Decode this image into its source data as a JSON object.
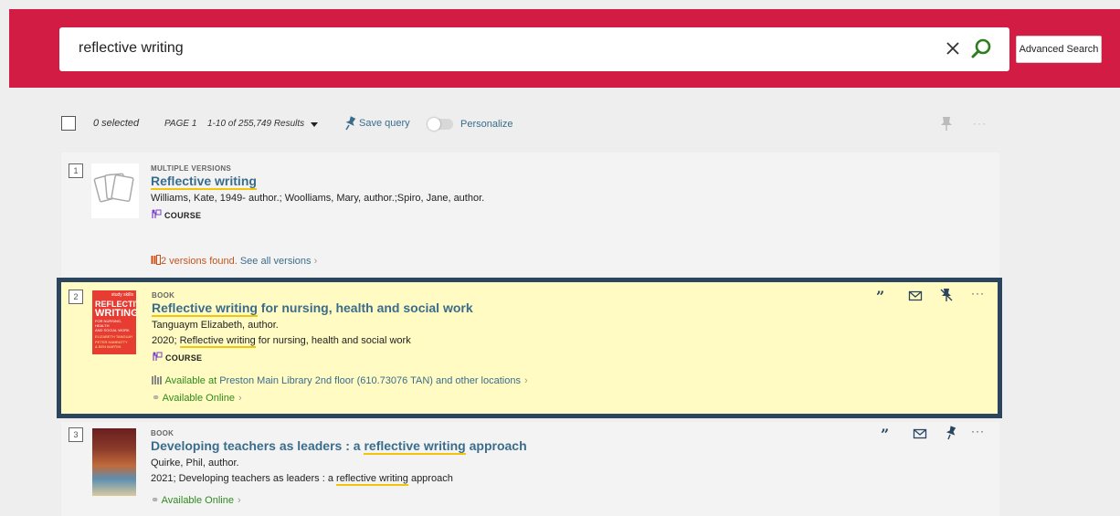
{
  "search": {
    "query": "reflective writing",
    "advanced_label": "Advanced Search"
  },
  "toolbar": {
    "selected": "0 selected",
    "page": "PAGE 1",
    "results": "1-10 of 255,749 Results",
    "save_query": "Save query",
    "personalize": "Personalize",
    "more": "···"
  },
  "results": [
    {
      "num": "1",
      "type": "MULTIPLE VERSIONS",
      "title_hl": "Reflective writing",
      "title_rest": "",
      "authors": "Williams, Kate, 1949- author.; Woolliams, Mary, author.;Spiro, Jane, author.",
      "course": "COURSE",
      "versions_found": "2 versions found.",
      "see_all": "See all versions"
    },
    {
      "num": "2",
      "type": "BOOK",
      "title_hl": "Reflective writing",
      "title_rest": " for nursing, health and social work",
      "authors": "Tanguaym Elizabeth, author.",
      "pub_prefix": "2020; ",
      "pub_hl": "Reflective writing",
      "pub_rest": " for nursing, health and social work",
      "course": "COURSE",
      "avail_at": "Available at",
      "location": "Preston Main Library  2nd floor (610.73076 TAN) and other locations",
      "online": "Available Online",
      "cover_lines": [
        "REFLECTIVE",
        "WRITING",
        "FOR NURSING, HEALTH",
        "AND SOCIAL WORK",
        "ELIZABETH TANGUAY",
        "PETER HANRATTY",
        "& BEN MARTIN"
      ],
      "cover_brand": "study skills",
      "more": "···"
    },
    {
      "num": "3",
      "type": "BOOK",
      "title_pre": "Developing teachers as leaders : a ",
      "title_hl": "reflective writing",
      "title_rest": " approach",
      "authors": "Quirke, Phil, author.",
      "pub_prefix": "2021; Developing teachers as leaders : a ",
      "pub_hl": "reflective writing",
      "pub_rest": " approach",
      "online": "Available Online",
      "more": "···"
    }
  ],
  "colors": {
    "header": "#d31c43",
    "link": "#3a6d8c",
    "highlight_bg": "#fffbc2",
    "focus_border": "#2b455f",
    "available": "#2e8b1e",
    "versions": "#c8531a"
  }
}
